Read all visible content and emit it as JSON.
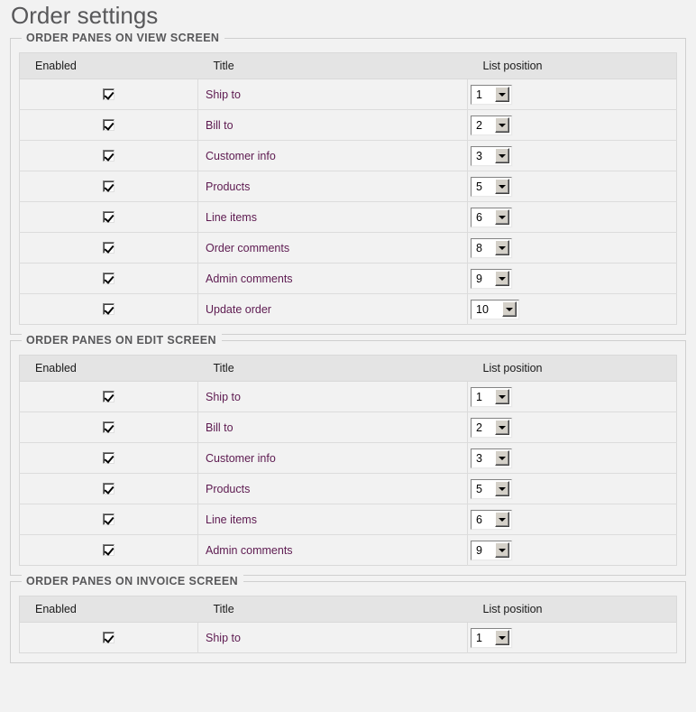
{
  "page": {
    "title": "Order settings",
    "accent_link_color": "#5d1a50",
    "header_bg": "#e4e4e4",
    "row_bg": "#f2f2f2"
  },
  "columns": {
    "enabled": "Enabled",
    "title": "Title",
    "list_position": "List position"
  },
  "sections": [
    {
      "legend": "ORDER PANES ON VIEW SCREEN",
      "rows": [
        {
          "enabled": true,
          "title": "Ship to",
          "position": "1"
        },
        {
          "enabled": true,
          "title": "Bill to",
          "position": "2"
        },
        {
          "enabled": true,
          "title": "Customer info",
          "position": "3"
        },
        {
          "enabled": true,
          "title": "Products",
          "position": "5"
        },
        {
          "enabled": true,
          "title": "Line items",
          "position": "6"
        },
        {
          "enabled": true,
          "title": "Order comments",
          "position": "8"
        },
        {
          "enabled": true,
          "title": "Admin comments",
          "position": "9"
        },
        {
          "enabled": true,
          "title": "Update order",
          "position": "10"
        }
      ]
    },
    {
      "legend": "ORDER PANES ON EDIT SCREEN",
      "rows": [
        {
          "enabled": true,
          "title": "Ship to",
          "position": "1"
        },
        {
          "enabled": true,
          "title": "Bill to",
          "position": "2"
        },
        {
          "enabled": true,
          "title": "Customer info",
          "position": "3"
        },
        {
          "enabled": true,
          "title": "Products",
          "position": "5"
        },
        {
          "enabled": true,
          "title": "Line items",
          "position": "6"
        },
        {
          "enabled": true,
          "title": "Admin comments",
          "position": "9"
        }
      ]
    },
    {
      "legend": "ORDER PANES ON INVOICE SCREEN",
      "rows": [
        {
          "enabled": true,
          "title": "Ship to",
          "position": "1"
        }
      ]
    }
  ]
}
